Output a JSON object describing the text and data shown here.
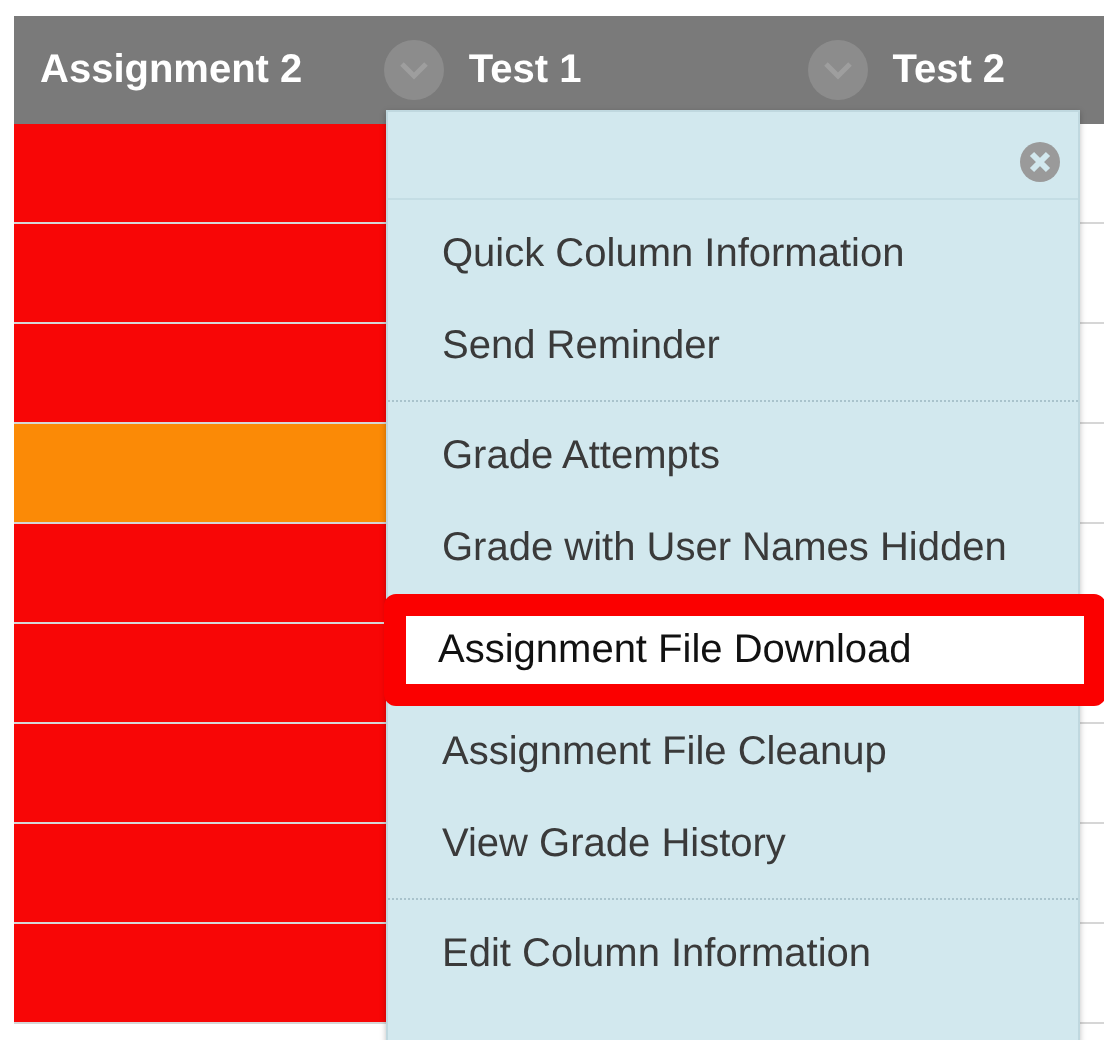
{
  "columns": [
    {
      "title": "Assignment 2",
      "menu_button": false
    },
    {
      "title": "Test 1",
      "menu_button": true
    },
    {
      "title": "Test 2",
      "menu_button": true
    }
  ],
  "rows": [
    {
      "color": "#f80606"
    },
    {
      "color": "#f80606"
    },
    {
      "color": "#f80606"
    },
    {
      "color": "#fb8a06"
    },
    {
      "color": "#f80606"
    },
    {
      "color": "#f80606"
    },
    {
      "color": "#f80606"
    },
    {
      "color": "#f80606"
    },
    {
      "color": "#f80606"
    }
  ],
  "menu": {
    "groups": [
      [
        {
          "label": "Quick Column Information",
          "highlighted": false
        },
        {
          "label": "Send Reminder",
          "highlighted": false
        }
      ],
      [
        {
          "label": "Grade Attempts",
          "highlighted": false
        },
        {
          "label": "Grade with User Names Hidden",
          "highlighted": false
        },
        {
          "label": "Assignment File Download",
          "highlighted": true
        },
        {
          "label": "Assignment File Cleanup",
          "highlighted": false
        },
        {
          "label": "View Grade History",
          "highlighted": false
        }
      ],
      [
        {
          "label": "Edit Column Information",
          "highlighted": false
        }
      ]
    ]
  }
}
